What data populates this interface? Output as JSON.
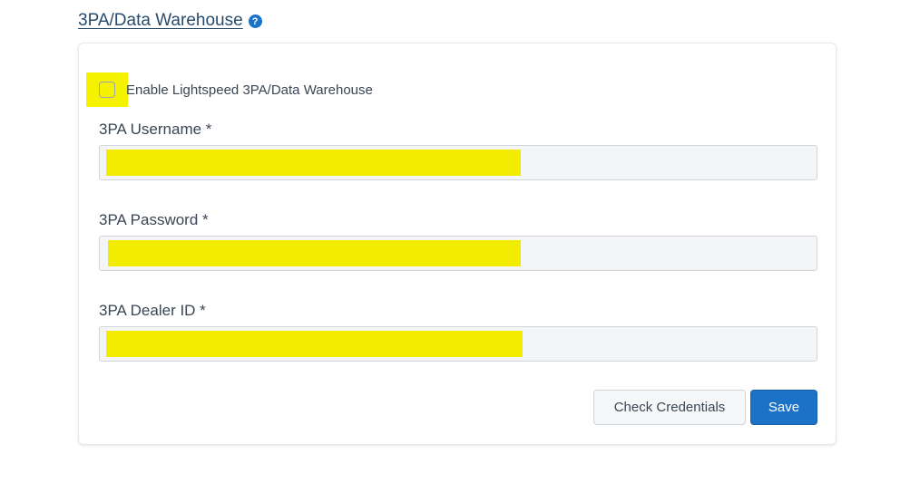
{
  "section": {
    "title": "3PA/Data Warehouse",
    "help_icon": "question-circle-icon",
    "help_glyph": "?"
  },
  "enable": {
    "label": "Enable Lightspeed 3PA/Data Warehouse",
    "checked": false
  },
  "fields": {
    "username": {
      "label": "3PA Username *",
      "value_redacted": true
    },
    "password": {
      "label": "3PA Password *",
      "value_redacted": true
    },
    "dealer_id": {
      "label": "3PA Dealer ID *",
      "value_redacted": true
    }
  },
  "actions": {
    "check_credentials_label": "Check Credentials",
    "save_label": "Save"
  },
  "colors": {
    "primary": "#1b72c6",
    "redaction_highlight": "#f2ec00",
    "title_link": "#274b6d"
  }
}
